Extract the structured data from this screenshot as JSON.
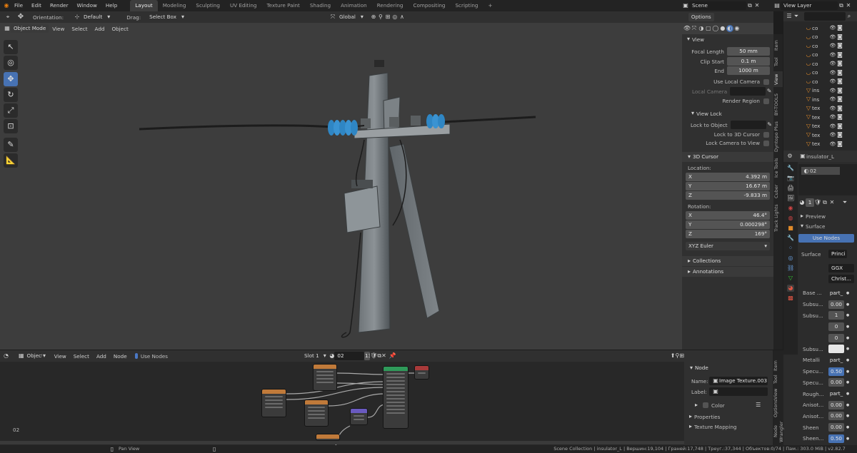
{
  "menubar": {
    "menus": [
      "File",
      "Edit",
      "Render",
      "Window",
      "Help"
    ],
    "workspaces": [
      "Layout",
      "Modeling",
      "Sculpting",
      "UV Editing",
      "Texture Paint",
      "Shading",
      "Animation",
      "Rendering",
      "Compositing",
      "Scripting"
    ],
    "active_workspace": "Layout",
    "scene_label": "Scene",
    "view_layer_label": "View Layer"
  },
  "viewport_header": {
    "orientation_label": "Orientation:",
    "orientation_value": "Default",
    "drag_label": "Drag:",
    "drag_value": "Select Box",
    "transform_space": "Global",
    "options_label": "Options",
    "mode": "Object Mode",
    "menus": [
      "View",
      "Select",
      "Add",
      "Object"
    ]
  },
  "npanel": {
    "tabs": [
      "Item",
      "Tool",
      "View",
      "BY-TOOLS",
      "Dyntopo Plus",
      "Ice Tools",
      "Cuber",
      "Track Lights"
    ],
    "view": {
      "header": "View",
      "focal_length_label": "Focal Length",
      "focal_length": "50 mm",
      "clip_start_label": "Clip Start",
      "clip_start": "0.1 m",
      "end_label": "End",
      "end": "1000 m",
      "use_local_camera": "Use Local Camera",
      "local_camera": "Local Camera",
      "render_region": "Render Region"
    },
    "view_lock": {
      "header": "View Lock",
      "lock_to_object": "Lock to Object",
      "lock_to_3d_cursor": "Lock to 3D Cursor",
      "lock_camera_to_view": "Lock Camera to View"
    },
    "cursor": {
      "header": "3D Cursor",
      "location_label": "Location:",
      "x": "4.392 m",
      "y": "16.67 m",
      "z": "-9.833 m",
      "rotation_label": "Rotation:",
      "rx": "46.4°",
      "ry": "0.000298°",
      "rz": "169°",
      "rotation_mode": "XYZ Euler"
    },
    "collections": "Collections",
    "annotations": "Annotations"
  },
  "outliner": {
    "items": [
      "co",
      "co",
      "co",
      "co",
      "co",
      "co",
      "co",
      "ins",
      "ins",
      "tex",
      "tex",
      "tex",
      "tex",
      "tex"
    ]
  },
  "properties": {
    "object_name": "insulator_L",
    "material_slot": "02",
    "user_count": "1",
    "preview": "Preview",
    "surface_header": "Surface",
    "use_nodes": "Use Nodes",
    "surface_label": "Surface",
    "surface_value": "Princi",
    "distribution": "GGX",
    "subsurface_method": "Christ...",
    "rows": [
      {
        "label": "Base ...",
        "value": "part_"
      },
      {
        "label": "Subsu...",
        "value": "0.00"
      },
      {
        "label": "Subsu...",
        "value": "1"
      },
      {
        "label": "",
        "value": "0"
      },
      {
        "label": "",
        "value": "0"
      },
      {
        "label": "Subsu...",
        "value": ""
      },
      {
        "label": "Metalli",
        "value": "part_"
      },
      {
        "label": "Specu...",
        "value": "0.50"
      },
      {
        "label": "Specu...",
        "value": "0.00"
      },
      {
        "label": "Rough...",
        "value": "part_"
      },
      {
        "label": "Anisot...",
        "value": "0.00"
      },
      {
        "label": "Anisot...",
        "value": "0.00"
      },
      {
        "label": "Sheen",
        "value": "0.00"
      },
      {
        "label": "Sheen...",
        "value": "0.50"
      }
    ]
  },
  "node_editor": {
    "object_label": "Object",
    "menus": [
      "View",
      "Select",
      "Add",
      "Node"
    ],
    "use_nodes": "Use Nodes",
    "slot": "Slot 1",
    "material": "02",
    "user_count": "13",
    "corner_label": "02",
    "side": {
      "node_header": "Node",
      "name_label": "Name:",
      "name_value": "Image Texture.003",
      "label_label": "Label:",
      "color_label": "Color",
      "properties": "Properties",
      "texture_mapping": "Texture Mapping"
    },
    "tabs": [
      "Item",
      "Tool",
      "View",
      "Options",
      "Node Wrangler"
    ]
  },
  "statusbar": {
    "pan_view": "Pan View",
    "info": "Scene Collection | insulator_L | Вершин:19,104 | Граней:17,748 | Треуг.:37,344 | Объектов:0/74 | Пам.: 303.0 MiB | v2.82.7"
  },
  "colors": {
    "accent": "#4772b3",
    "viewport_bg": "#3d3d3d",
    "insulator": "#2f86c4"
  }
}
